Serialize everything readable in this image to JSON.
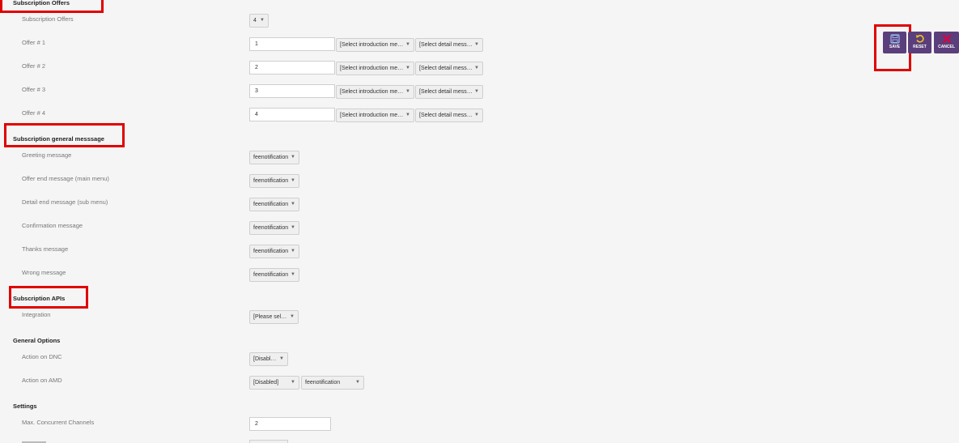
{
  "sections": {
    "subscription_offers": "Subscription Offers",
    "general_message": "Subscription general messsage",
    "apis": "Subscription APIs",
    "general_options": "General Options",
    "settings": "Settings"
  },
  "subscription_offers": {
    "label": "Subscription Offers",
    "value": "4",
    "offers": [
      {
        "label": "Offer # 1",
        "value": "1",
        "intro": "[Select introduction mes...",
        "detail": "[Select detail message]"
      },
      {
        "label": "Offer # 2",
        "value": "2",
        "intro": "[Select introduction mes...",
        "detail": "[Select detail message]"
      },
      {
        "label": "Offer # 3",
        "value": "3",
        "intro": "[Select introduction mes...",
        "detail": "[Select detail message]"
      },
      {
        "label": "Offer # 4",
        "value": "4",
        "intro": "[Select introduction mes...",
        "detail": "[Select detail message]"
      }
    ]
  },
  "general_messages": [
    {
      "label": "Greeting message",
      "value": "feenotification"
    },
    {
      "label": "Offer end message (main menu)",
      "value": "feenotification"
    },
    {
      "label": "Detail end message (sub menu)",
      "value": "feenotification"
    },
    {
      "label": "Confirmation message",
      "value": "feenotification"
    },
    {
      "label": "Thanks message",
      "value": "feenotification"
    },
    {
      "label": "Wrong message",
      "value": "feenotification"
    }
  ],
  "apis": {
    "integration_label": "Integration",
    "integration_value": "[Please select]"
  },
  "general_options": {
    "dnc_label": "Action on DNC",
    "dnc_value": "[Disabled]",
    "amd_label": "Action on AMD",
    "amd_value": "[Disabled]",
    "amd_message": "feenotification"
  },
  "settings": {
    "max_channels_label": "Max. Concurrent Channels",
    "max_channels_value": "2"
  },
  "toolbar": {
    "save": "SAVE",
    "reset": "RESET",
    "cancel": "CANCEL"
  },
  "colors": {
    "button_bg": "#5b3f7c",
    "highlight": "#e00000",
    "reset_icon": "#f0c020",
    "cancel_icon": "#e0003c"
  }
}
